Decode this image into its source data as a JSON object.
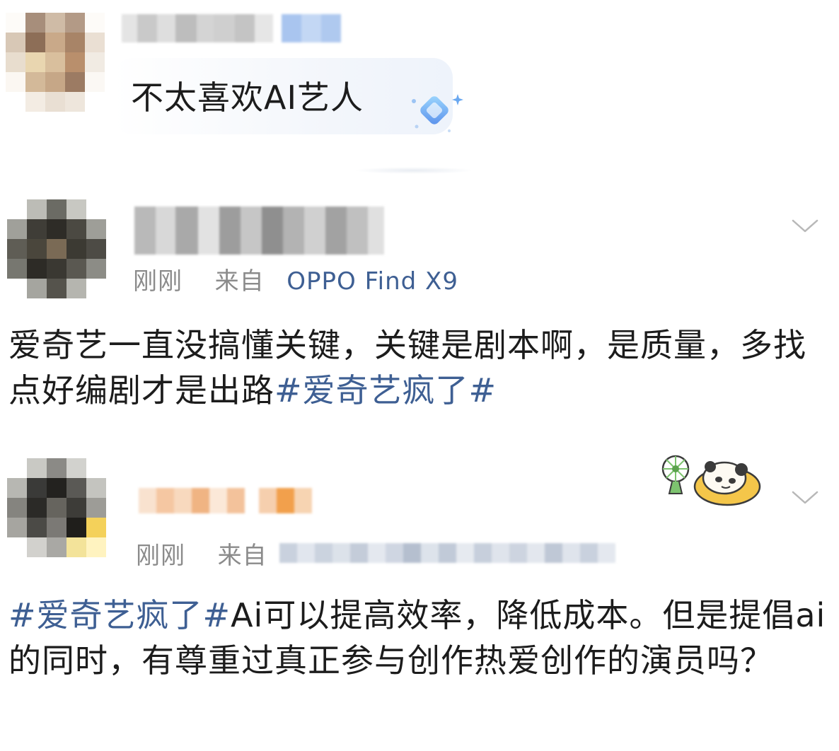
{
  "quoted_comment": {
    "text": "不太喜欢AI艺人",
    "badge_icon": "sparkle-diamond-icon"
  },
  "comments": [
    {
      "time": "刚刚",
      "source_prefix": "来自",
      "device": "OPPO Find X9",
      "body_text": "爱奇艺一直没搞懂关键，关键是剧本啊，是质量，多找点好编剧才是出路",
      "hashtag": "#爱奇艺疯了#"
    },
    {
      "time": "刚刚",
      "source_prefix": "来自",
      "hashtag": "#爱奇艺疯了#",
      "body_text": "Ai可以提高效率，降低成本。但是提倡ai的同时，有尊重过真正参与创作热爱创作的演员吗？",
      "sticker_icon": "panda-fan-sticker-icon"
    }
  ],
  "colors": {
    "hashtag": "#3e5f93",
    "meta": "#8b8b8b",
    "text": "#1c1c1c"
  }
}
